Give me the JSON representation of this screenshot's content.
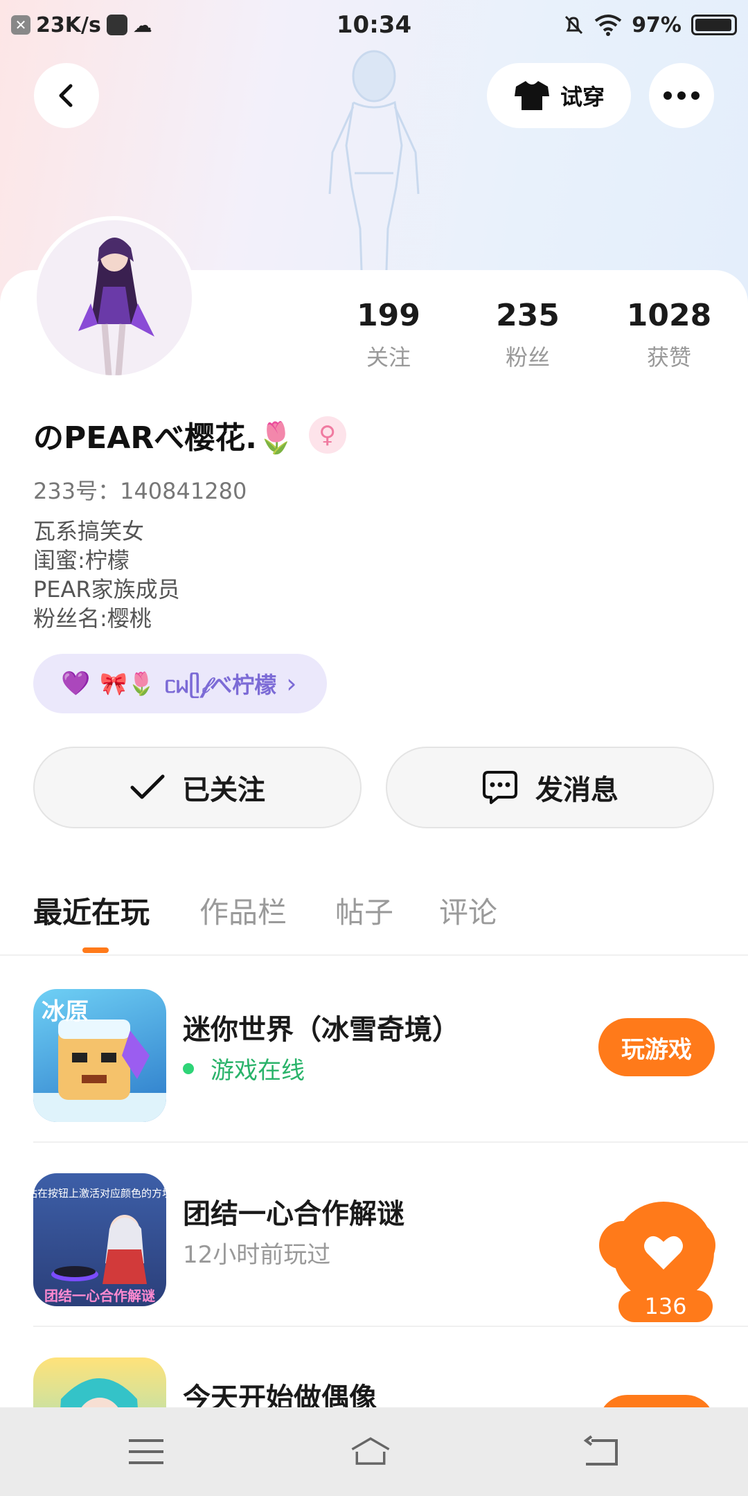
{
  "status_bar": {
    "speed": "23K/s",
    "time": "10:34",
    "battery": "97%",
    "battery_level": 0.97
  },
  "header": {
    "back_icon": "chevron-left-icon",
    "tryon_label": "试穿",
    "tryon_icon": "shirt-icon",
    "more_icon": "more-dots-icon"
  },
  "profile": {
    "stats": [
      {
        "value": "199",
        "label": "关注"
      },
      {
        "value": "235",
        "label": "粉丝"
      },
      {
        "value": "1028",
        "label": "获赞"
      }
    ],
    "name": "のPEARべ樱花.🌷",
    "gender_symbol": "♀",
    "id_line": "233号：140841280",
    "bio": [
      "瓦系搞笑女",
      "闺蜜:柠檬",
      "PEAR家族成员",
      "粉丝名:樱桃"
    ],
    "cp": {
      "heart_glyph": "💜",
      "emoji": "🎀🌷",
      "name": "ᥴᥕᥫ𝒻べ柠檬",
      "arrow": "›"
    }
  },
  "actions": {
    "follow_label": "已关注",
    "message_label": "发消息"
  },
  "tabs": [
    {
      "label": "最近在玩",
      "active": true
    },
    {
      "label": "作品栏",
      "active": false
    },
    {
      "label": "帖子",
      "active": false
    },
    {
      "label": "评论",
      "active": false
    }
  ],
  "games": [
    {
      "title": "迷你世界（冰雪奇境）",
      "subtitle": "游戏在线",
      "online": true,
      "button": "玩游戏",
      "icon_text": "冰原"
    },
    {
      "title": "团结一心合作解谜",
      "subtitle": "12小时前玩过",
      "online": false,
      "icon_text_top": "站在按钮上激活对应颜色的方块",
      "icon_text_bottom": "团结一心合作解谜"
    },
    {
      "title": "今天开始做偶像",
      "subtitle": "",
      "online": false
    }
  ],
  "like_fab": {
    "count": "136"
  },
  "colors": {
    "accent": "#ff7a1a",
    "online": "#2ab36a",
    "cp_text": "#7c6bd6"
  }
}
